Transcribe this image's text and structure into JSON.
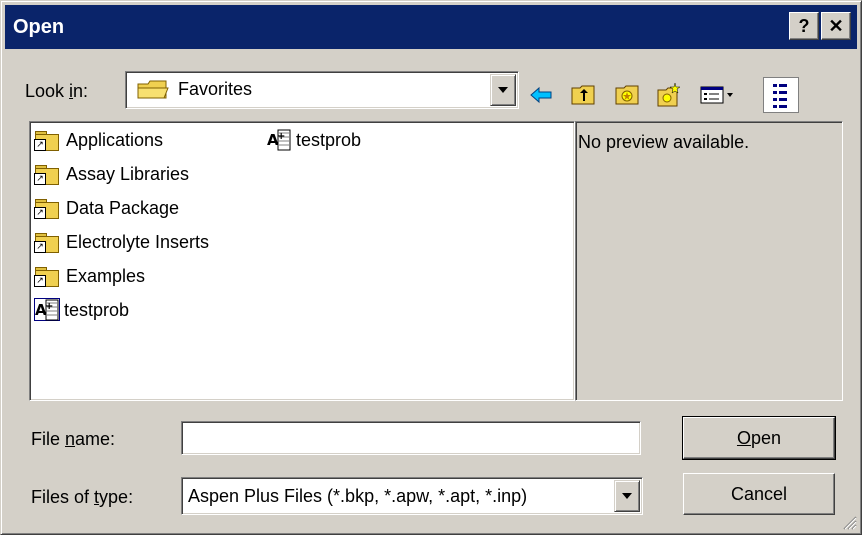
{
  "window": {
    "title": "Open",
    "help_label": "?",
    "close_label": "✕"
  },
  "lookin": {
    "label_pre": "Look ",
    "label_accel": "i",
    "label_post": "n:",
    "value": "Favorites"
  },
  "toolbar": {
    "icons": [
      "back-icon",
      "up-folder-icon",
      "favorites-folder-icon",
      "new-folder-icon",
      "view-menu-icon",
      "details-view-icon"
    ]
  },
  "files": {
    "col1": [
      {
        "name": "Applications",
        "type": "folder-shortcut"
      },
      {
        "name": "Assay Libraries",
        "type": "folder-shortcut"
      },
      {
        "name": "Data Package",
        "type": "folder-shortcut"
      },
      {
        "name": "Electrolyte Inserts",
        "type": "folder-shortcut"
      },
      {
        "name": "Examples",
        "type": "folder-shortcut"
      },
      {
        "name": "testprob",
        "type": "aspen-file"
      }
    ],
    "col2": [
      {
        "name": "testprob",
        "type": "aspen-file"
      }
    ]
  },
  "preview": {
    "text": "No preview available."
  },
  "filename": {
    "label_pre": "File ",
    "label_accel": "n",
    "label_post": "ame:",
    "value": ""
  },
  "filetype": {
    "label_pre": "Files of ",
    "label_accel": "t",
    "label_post": "ype:",
    "value": "Aspen Plus Files (*.bkp, *.apw, *.apt, *.inp)"
  },
  "buttons": {
    "open_accel": "O",
    "open_rest": "pen",
    "cancel": "Cancel"
  }
}
